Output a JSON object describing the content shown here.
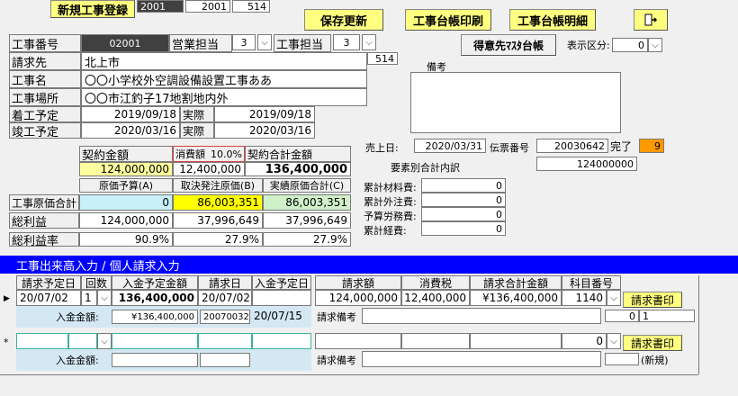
{
  "toolbar": {
    "new_btn": "新規工事登録",
    "pager": [
      "2001",
      "2001",
      "514"
    ],
    "save_btn": "保存更新",
    "ledger_print_btn": "工事台帳印刷",
    "ledger_detail_btn": "工事台帳明細",
    "client_master_btn": "得意先ﾏｽﾀ台帳"
  },
  "header": {
    "job_no_label": "工事番号",
    "job_no": "02001",
    "sales_label": "営業担当",
    "sales_val": "3",
    "work_label": "工事担当",
    "work_val": "3",
    "client_label": "請求先",
    "client": "北上市",
    "client_code": "514",
    "name_label": "工事名",
    "name": "〇〇小学校外空調設備設置工事ああ",
    "place_label": "工事場所",
    "place": "〇〇市江釣子17地割地内外",
    "start_label": "着工予定",
    "start_plan": "2019/09/18",
    "actual_label": "実際",
    "start_actual": "2019/09/18",
    "end_label": "竣工予定",
    "end_plan": "2020/03/16",
    "end_actual": "2020/03/16",
    "display_label": "表示区分:",
    "display_val": "0",
    "memo_label": "備考",
    "sales_date_label": "売上日:",
    "sales_date": "2020/03/31",
    "slip_label": "伝票番号",
    "slip_no": "20030642",
    "done_label": "完了",
    "done_val": "9",
    "cost_summary_val": "124000000",
    "breakdown_label": "要素別合計内訳"
  },
  "contract": {
    "amount_label": "契約金額",
    "tax_label": "消費額",
    "tax_rate": "10.0%",
    "total_label": "契約合計金額",
    "amount": "124,000,000",
    "tax": "12,400,000",
    "total": "136,400,000"
  },
  "cost": {
    "col_a": "原価予算(A)",
    "col_b": "取決発注原価(B)",
    "col_c": "実績原価合計(C)",
    "row1_label": "工事原価合計",
    "row1": [
      "0",
      "86,003,351",
      "86,003,351"
    ],
    "row2_label": "総利益",
    "row2": [
      "124,000,000",
      "37,996,649",
      "37,996,649"
    ],
    "row3_label": "総利益率",
    "row3": [
      "90.9%",
      "27.9%",
      "27.9%"
    ]
  },
  "breakdown": {
    "items": [
      {
        "label": "累計材料費:",
        "value": "0"
      },
      {
        "label": "累計外注費:",
        "value": "0"
      },
      {
        "label": "予算労務費:",
        "value": "0"
      },
      {
        "label": "累計経費:",
        "value": "0"
      }
    ]
  },
  "section": {
    "title": "工事出来高入力 / 個人請求入力"
  },
  "grid": {
    "headers": [
      "請求予定日",
      "回数",
      "入金予定金額",
      "請求日",
      "入金予定日",
      "請求額",
      "消費税",
      "請求合計金額",
      "科目番号"
    ],
    "row1": {
      "plan_date": "20/07/02",
      "count": "1",
      "plan_amount": "136,400,000",
      "bill_date": "20/07/02",
      "pay_date": "",
      "bill": "124,000,000",
      "tax": "12,400,000",
      "total": "¥136,400,000",
      "subject": "1140",
      "print_btn": "請求書印",
      "paid_label": "入金金額:",
      "paid_amount": "¥136,400,000",
      "paid_code": "20070032",
      "paid_date": "20/07/15",
      "memo_label": "請求備考",
      "memo": "",
      "small_a": "0",
      "small_b": "1"
    },
    "row2": {
      "print_btn": "請求書印",
      "subject": "0",
      "paid_label": "入金金額:",
      "memo_label": "請求備考",
      "new_tag": "(新規)"
    }
  },
  "colors": {
    "section_bar": "#0000ff",
    "highlight_yellow": "#ffff00",
    "cell_yellow": "#ffffa0",
    "cell_cyan": "#c8f0f8",
    "cell_green": "#d0f0c8",
    "done_orange": "#ff9900"
  }
}
